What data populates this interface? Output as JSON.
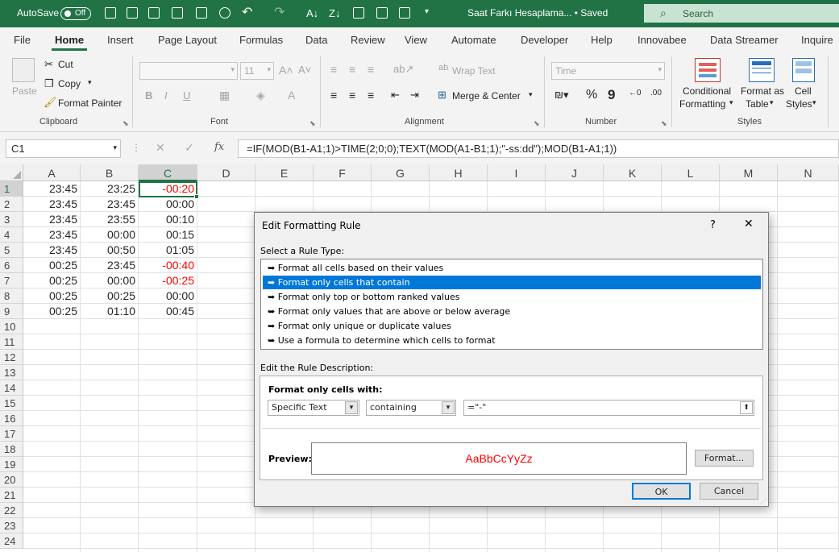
{
  "titlebar": {
    "autosave_label": "AutoSave",
    "autosave_state": "Off",
    "document_title": "Saat Farkı Hesaplama...  • Saved",
    "search_placeholder": "Search"
  },
  "ribbon_tabs": [
    "File",
    "Home",
    "Insert",
    "Page Layout",
    "Formulas",
    "Data",
    "Review",
    "View",
    "Automate",
    "Developer",
    "Help",
    "Innovabee",
    "Data Streamer",
    "Inquire"
  ],
  "active_tab": "Home",
  "ribbon": {
    "clipboard": {
      "paste": "Paste",
      "cut": "Cut",
      "copy": "Copy",
      "format_painter": "Format Painter",
      "group": "Clipboard"
    },
    "font": {
      "font_size": "11",
      "bold": "B",
      "italic": "I",
      "underline": "U",
      "group": "Font"
    },
    "alignment": {
      "wrap_text": "Wrap Text",
      "merge_center": "Merge & Center",
      "group": "Alignment"
    },
    "number": {
      "format": "Time",
      "percent": "%",
      "comma": "9",
      "group": "Number"
    },
    "styles": {
      "conditional_formatting": [
        "Conditional",
        "Formatting"
      ],
      "format_as_table": [
        "Format as",
        "Table"
      ],
      "cell_styles": [
        "Cell",
        "Styles"
      ],
      "group": "Styles"
    }
  },
  "formula_bar": {
    "name_box": "C1",
    "formula": "=IF(MOD(B1-A1;1)>TIME(2;0;0);TEXT(MOD(A1-B1;1);\"-ss:dd\");MOD(B1-A1;1))"
  },
  "grid": {
    "columns": [
      "A",
      "B",
      "C",
      "D",
      "E",
      "F",
      "G",
      "H",
      "I",
      "J",
      "K",
      "L",
      "M",
      "N"
    ],
    "rows": [
      "1",
      "2",
      "3",
      "4",
      "5",
      "6",
      "7",
      "8",
      "9",
      "10",
      "11",
      "12",
      "13",
      "14",
      "15",
      "16",
      "17",
      "18",
      "19",
      "20",
      "21",
      "22",
      "23",
      "24"
    ],
    "data": [
      {
        "a": "23:45",
        "b": "23:25",
        "c": "-00:20",
        "neg": true
      },
      {
        "a": "23:45",
        "b": "23:45",
        "c": "00:00",
        "neg": false
      },
      {
        "a": "23:45",
        "b": "23:55",
        "c": "00:10",
        "neg": false
      },
      {
        "a": "23:45",
        "b": "00:00",
        "c": "00:15",
        "neg": false
      },
      {
        "a": "23:45",
        "b": "00:50",
        "c": "01:05",
        "neg": false
      },
      {
        "a": "00:25",
        "b": "23:45",
        "c": "-00:40",
        "neg": true
      },
      {
        "a": "00:25",
        "b": "00:00",
        "c": "-00:25",
        "neg": true
      },
      {
        "a": "00:25",
        "b": "00:25",
        "c": "00:00",
        "neg": false
      },
      {
        "a": "00:25",
        "b": "01:10",
        "c": "00:45",
        "neg": false
      }
    ],
    "negative_color": "#ff0000"
  },
  "dialog": {
    "title": "Edit Formatting Rule",
    "help": "?",
    "close": "✕",
    "select_rule_type_label": "Select a Rule Type:",
    "rule_types": [
      "Format all cells based on their values",
      "Format only cells that contain",
      "Format only top or bottom ranked values",
      "Format only values that are above or below average",
      "Format only unique or duplicate values",
      "Use a formula to determine which cells to format"
    ],
    "selected_rule_index": 1,
    "edit_description_label": "Edit the Rule Description:",
    "format_only_cells_with": "Format only cells with:",
    "condition_type": "Specific Text",
    "operator": "containing",
    "value": "=\"-\"",
    "preview_label": "Preview:",
    "preview_text": "AaBbCcYyZz",
    "format_button": "Format...",
    "ok_button": "OK",
    "cancel_button": "Cancel"
  }
}
